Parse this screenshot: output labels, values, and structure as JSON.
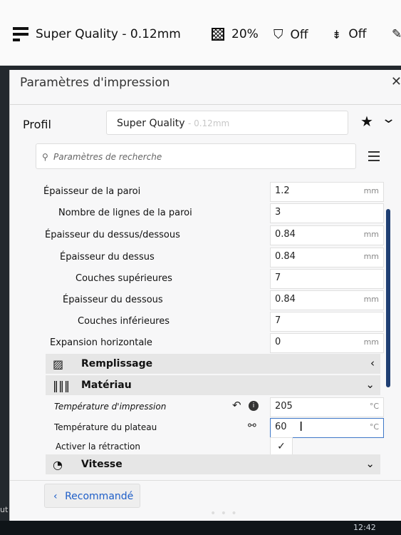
{
  "topbar": {
    "profile": "Super Quality - 0.12mm",
    "infill": "20%",
    "support": "Off",
    "adhesion": "Off"
  },
  "dialog": {
    "title": "Paramètres d'impression",
    "profile_label": "Profil",
    "profile_name": "Super Quality",
    "profile_suffix": "- 0.12mm",
    "search_placeholder": "Paramètres de recherche"
  },
  "settings": [
    {
      "label": "Épaisseur de la paroi",
      "value": "1.2",
      "unit": "mm"
    },
    {
      "label": "Nombre de lignes de la paroi",
      "value": "3",
      "unit": ""
    },
    {
      "label": "Épaisseur du dessus/dessous",
      "value": "0.84",
      "unit": "mm"
    },
    {
      "label": "Épaisseur du dessus",
      "value": "0.84",
      "unit": "mm"
    },
    {
      "label": "Couches supérieures",
      "value": "7",
      "unit": ""
    },
    {
      "label": "Épaisseur du dessous",
      "value": "0.84",
      "unit": "mm"
    },
    {
      "label": "Couches inférieures",
      "value": "7",
      "unit": ""
    },
    {
      "label": "Expansion horizontale",
      "value": "0",
      "unit": "mm"
    }
  ],
  "sections": {
    "remplissage": "Remplissage",
    "materiau": "Matériau",
    "vitesse": "Vitesse"
  },
  "material": {
    "print_temp_label": "Température d'impression",
    "print_temp_value": "205",
    "print_temp_unit": "°C",
    "bed_temp_label": "Température du plateau",
    "bed_temp_value": "60",
    "bed_temp_unit": "°C",
    "retraction_label": "Activer la rétraction",
    "retraction_check": "✓"
  },
  "footer": {
    "recommande": "Recommandé"
  },
  "status": {
    "clock": "12:42",
    "left_text": "ut"
  }
}
